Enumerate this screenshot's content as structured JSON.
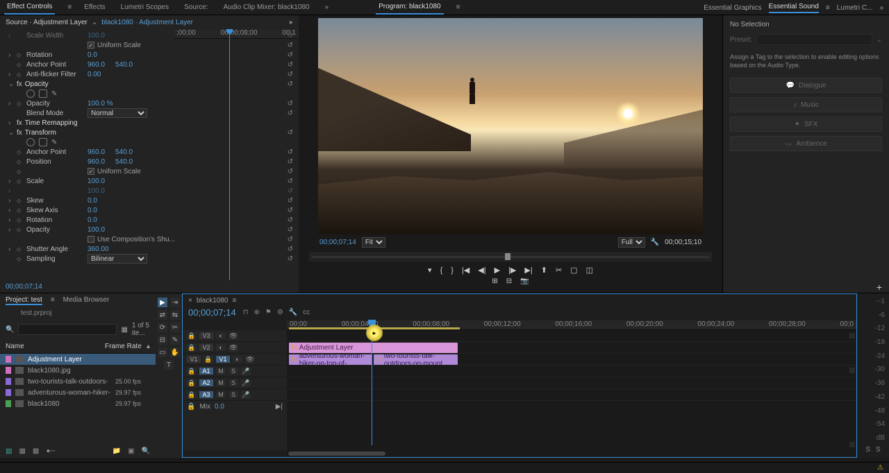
{
  "top_tabs": {
    "effect_controls": "Effect Controls",
    "effects": "Effects",
    "lumetri_scopes": "Lumetri Scopes",
    "source": "Source:",
    "audio_mixer": "Audio Clip Mixer: black1080",
    "program": "Program: black1080"
  },
  "right_tabs": {
    "essential_graphics": "Essential Graphics",
    "essential_sound": "Essential Sound",
    "lumetri_c": "Lumetri C..."
  },
  "source_bar": {
    "source": "Source · Adjustment Layer",
    "seq": "black1080 · Adjustment Layer"
  },
  "mini_ruler": {
    "m0": ";00;00",
    "m1": "00;00;08;00",
    "m2": "00;1"
  },
  "props": {
    "scale_width": "Scale Width",
    "scale_width_val": "100.0",
    "uniform_scale": "Uniform Scale",
    "rotation": "Rotation",
    "rotation_val": "0.0",
    "anchor": "Anchor Point",
    "anchor_x": "960.0",
    "anchor_y": "540.0",
    "flicker": "Anti-flicker Filter",
    "flicker_val": "0.00",
    "opacity_fx": "Opacity",
    "opacity": "Opacity",
    "opacity_val": "100.0 %",
    "blend": "Blend Mode",
    "blend_val": "Normal",
    "timeremap": "Time Remapping",
    "transform_fx": "Transform",
    "t_anchor": "Anchor Point",
    "t_anchor_x": "960.0",
    "t_anchor_y": "540.0",
    "t_position": "Position",
    "t_pos_x": "960.0",
    "t_pos_y": "540.0",
    "t_uniform": "Uniform Scale",
    "t_scale": "Scale",
    "t_scale_val": "100.0",
    "t_scale2_val": "100.0",
    "t_skew": "Skew",
    "t_skew_val": "0.0",
    "t_skewaxis": "Skew Axis",
    "t_skewaxis_val": "0.0",
    "t_rotation": "Rotation",
    "t_rotation_val": "0.0",
    "t_opacity": "Opacity",
    "t_opacity_val": "100.0",
    "t_usecomp": "Use Composition's Shu...",
    "t_shutter": "Shutter Angle",
    "t_shutter_val": "360.00",
    "t_sampling": "Sampling",
    "t_sampling_val": "Bilinear"
  },
  "timecode_mini": "00;00;07;14",
  "program_bar": {
    "tc_left": "00;00;07;14",
    "zoom": "Fit",
    "quality": "Full",
    "tc_right": "00;00;15;10"
  },
  "ess": {
    "no_sel": "No Selection",
    "preset": "Preset:",
    "hint": "Assign a Tag to the selection to enable editing options based on the Audio Type.",
    "dialogue": "Dialogue",
    "music": "Music",
    "sfx": "SFX",
    "ambience": "Ambience"
  },
  "project": {
    "tab_project": "Project: test",
    "tab_media": "Media Browser",
    "file": "test.prproj",
    "count": "1 of 5 ite...",
    "col_name": "Name",
    "col_rate": "Frame Rate",
    "items": [
      {
        "color": "#d070c0",
        "name": "Adjustment Layer",
        "rate": ""
      },
      {
        "color": "#d070c0",
        "name": "black1080.jpg",
        "rate": ""
      },
      {
        "color": "#8a6ad8",
        "name": "two-tourists-talk-outdoors-",
        "rate": "25.00 fps"
      },
      {
        "color": "#8a6ad8",
        "name": "adventurous-woman-hiker-",
        "rate": "29.97 fps"
      },
      {
        "color": "#4aa050",
        "name": "black1080",
        "rate": "29.97 fps"
      }
    ]
  },
  "timeline": {
    "seq_name": "black1080",
    "tc": "00;00;07;14",
    "ruler": [
      "00;00",
      "00;00;04;00",
      "00;00;08;00",
      "00;00;12;00",
      "00;00;16;00",
      "00;00;20;00",
      "00;00;24;00",
      "00;00;28;00",
      "00;0"
    ],
    "tracks": {
      "v3": "V3",
      "v2": "V2",
      "v1": "V1",
      "v1src": "V1",
      "a1": "A1",
      "a2": "A2",
      "a3": "A3",
      "mix": "Mix",
      "mix_val": "0.0"
    },
    "btns": {
      "lock": "🔒",
      "mute": "M",
      "solo": "S",
      "eye": "👁",
      "mic": "🎤",
      "o": "○"
    },
    "clips": {
      "adj": "Adjustment Layer",
      "c1": "adventurous-woman-hiker-on-top-of-",
      "c2": "two-tourists-talk-outdoors-on-mount"
    }
  },
  "meters": {
    "marks": [
      "--1",
      "-6",
      "-12",
      "-18",
      "-24",
      "-30",
      "-36",
      "-42",
      "-48",
      "-54",
      "dB"
    ],
    "solo": "S"
  }
}
